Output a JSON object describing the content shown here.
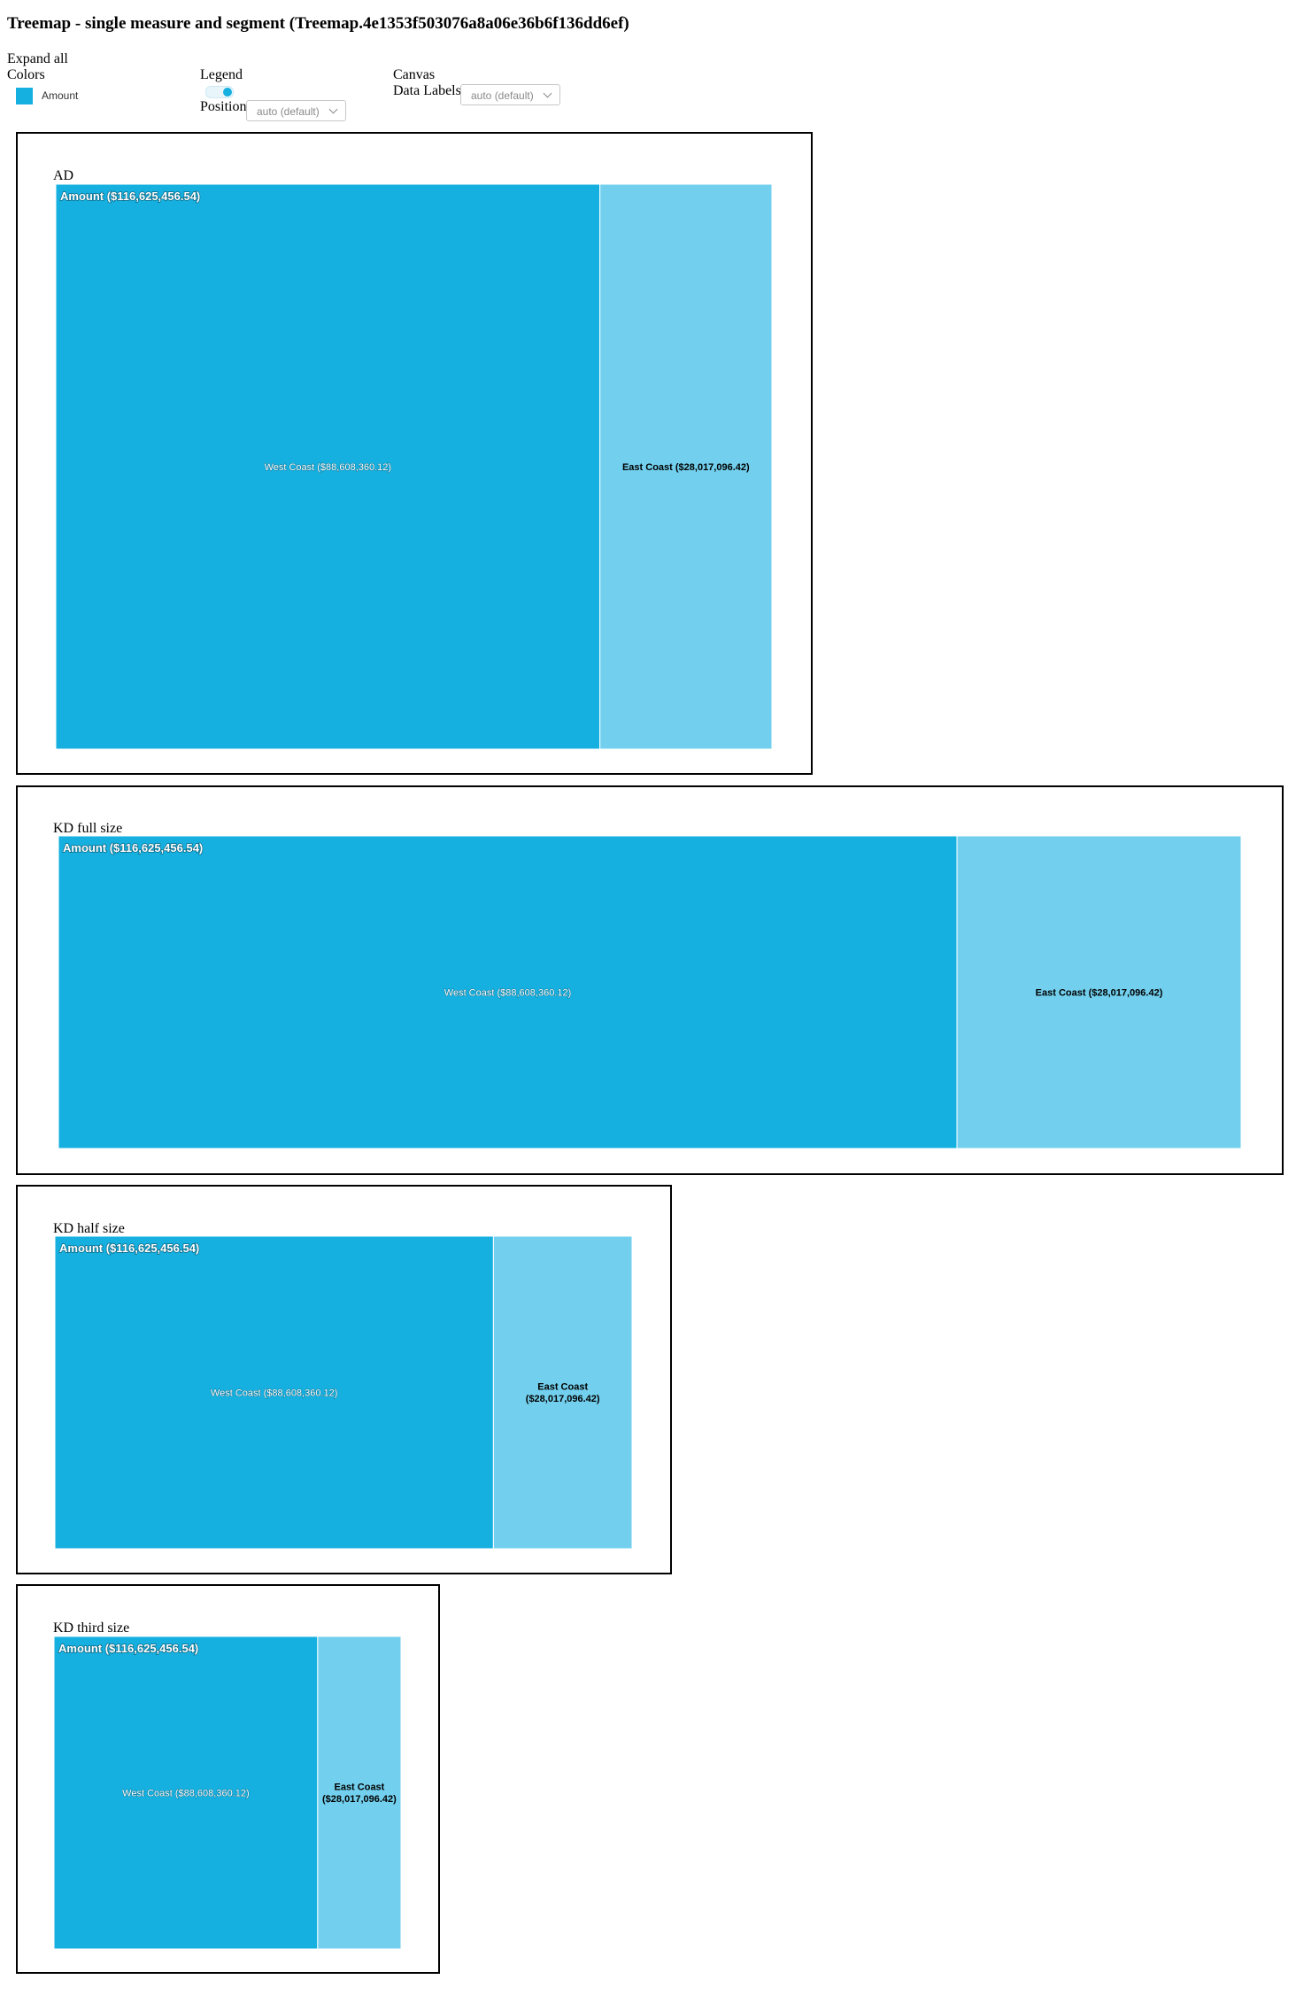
{
  "title": "Treemap - single measure and segment (Treemap.4e1353f503076a8a06e36b6f136dd6ef)",
  "controls": {
    "expand_all": "Expand all",
    "colors": "Colors",
    "legend": "Legend",
    "position": "Position",
    "position_value": "auto (default)",
    "canvas": "Canvas",
    "data_labels": "Data Labels",
    "data_labels_value": "auto (default)"
  },
  "legend": {
    "item": "Amount",
    "color": "#15b0e0",
    "enabled": true
  },
  "colors": {
    "primary": "#15b0e0",
    "secondary": "#72d0ee",
    "label_light": "#ffffff",
    "label_dark": "#000000"
  },
  "panels": [
    {
      "label": "AD"
    },
    {
      "label": "KD full size"
    },
    {
      "label": "KD half size"
    },
    {
      "label": "KD third size"
    }
  ],
  "chart_data": {
    "type": "treemap",
    "header": "Amount ($116,625,456.54)",
    "total": 116625456.54,
    "segments": [
      {
        "name": "West Coast",
        "value": 88608360.12,
        "label": "West Coast ($88,608,360.12)"
      },
      {
        "name": "East Coast",
        "value": 28017096.42,
        "label": "East Coast ($28,017,096.42)"
      }
    ]
  }
}
